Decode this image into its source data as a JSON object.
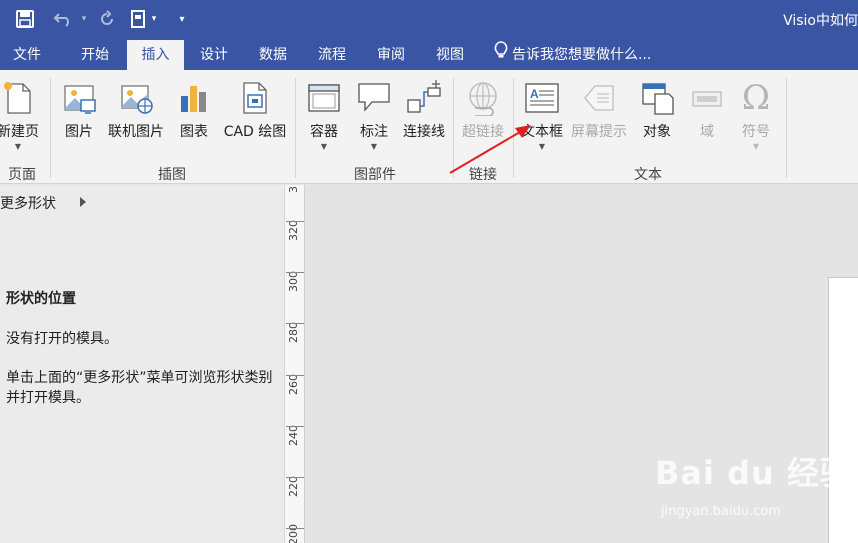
{
  "window": {
    "title": "Visio中如何"
  },
  "quick_access": [
    {
      "name": "save-icon",
      "glyph": "💾"
    },
    {
      "name": "undo-icon",
      "glyph": "↶"
    },
    {
      "name": "redo-icon",
      "glyph": "↻"
    },
    {
      "name": "new-page-icon",
      "glyph": "▯"
    },
    {
      "name": "customize-icon",
      "glyph": "▾"
    }
  ],
  "menu": {
    "tabs": [
      "文件",
      "开始",
      "插入",
      "设计",
      "数据",
      "流程",
      "审阅",
      "视图"
    ],
    "active_tab": "插入",
    "tell_me": "告诉我您想要做什么..."
  },
  "ribbon": {
    "groups": [
      {
        "label": "页面",
        "buttons": [
          {
            "label": "新建页",
            "icon": "new-page-icon",
            "dropdown": true
          }
        ]
      },
      {
        "label": "插图",
        "buttons": [
          {
            "label": "图片",
            "icon": "picture-icon"
          },
          {
            "label": "联机图片",
            "icon": "online-picture-icon"
          },
          {
            "label": "图表",
            "icon": "chart-icon"
          },
          {
            "label": "CAD 绘图",
            "icon": "cad-drawing-icon"
          }
        ]
      },
      {
        "label": "图部件",
        "buttons": [
          {
            "label": "容器",
            "icon": "container-icon",
            "dropdown": true
          },
          {
            "label": "标注",
            "icon": "callout-icon",
            "dropdown": true
          },
          {
            "label": "连接线",
            "icon": "connector-icon"
          }
        ]
      },
      {
        "label": "链接",
        "buttons": [
          {
            "label": "超链接",
            "icon": "hyperlink-icon",
            "disabled": true
          }
        ]
      },
      {
        "label": "文本",
        "buttons": [
          {
            "label": "文本框",
            "icon": "textbox-icon",
            "dropdown": true
          },
          {
            "label": "屏幕提示",
            "icon": "screentip-icon",
            "disabled": true
          },
          {
            "label": "对象",
            "icon": "object-icon"
          },
          {
            "label": "域",
            "icon": "field-icon",
            "disabled": true
          },
          {
            "label": "符号",
            "icon": "symbol-icon",
            "disabled": true,
            "dropdown": true
          }
        ]
      }
    ]
  },
  "shapes_pane": {
    "more_shapes": "更多形状",
    "heading": "形状的位置",
    "message1": "没有打开的模具。",
    "message2": "单击上面的“更多形状”菜单可浏览形状类别并打开模具。"
  },
  "ruler": {
    "labels": [
      "3",
      "320",
      "300",
      "280",
      "260",
      "240",
      "220",
      "200"
    ]
  },
  "watermark": {
    "logo": "Bai du 经验",
    "sub": "jingyan.baidu.com"
  },
  "colors": {
    "accent": "#3955a3",
    "ribbon_bg": "#f3f3f3",
    "annotation_arrow": "#e02020"
  }
}
